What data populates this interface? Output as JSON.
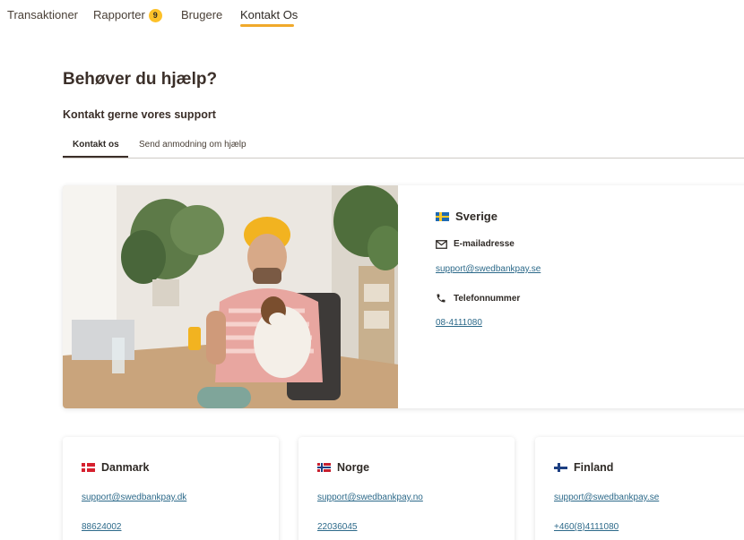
{
  "nav": {
    "items": [
      {
        "label": "Transaktioner"
      },
      {
        "label": "Rapporter",
        "badge": "9"
      },
      {
        "label": "Brugere"
      },
      {
        "label": "Kontakt Os"
      }
    ]
  },
  "page": {
    "title": "Behøver du hjælp?",
    "subtitle": "Kontakt gerne vores support"
  },
  "tabs": [
    {
      "label": "Kontakt os"
    },
    {
      "label": "Send anmodning om hjælp"
    }
  ],
  "main": {
    "country": "Sverige",
    "flag_icon": "sweden-flag-icon",
    "email_label": "E-mailadresse",
    "email_icon": "envelope-icon",
    "email": "support@swedbankpay.se",
    "phone_label": "Telefonnummer",
    "phone_icon": "phone-icon",
    "phone": "08-4111080"
  },
  "cards": [
    {
      "country": "Danmark",
      "flag_icon": "denmark-flag-icon",
      "email": "support@swedbankpay.dk",
      "phone": "88624002"
    },
    {
      "country": "Norge",
      "flag_icon": "norway-flag-icon",
      "email": "support@swedbankpay.no",
      "phone": "22036045"
    },
    {
      "country": "Finland",
      "flag_icon": "finland-flag-icon",
      "email": "support@swedbankpay.se",
      "phone": "+460(8)4111080"
    }
  ],
  "colors": {
    "accent": "#f0a92b",
    "badge": "#fdc129",
    "link": "#2d6a8a",
    "text": "#2f2a26"
  }
}
